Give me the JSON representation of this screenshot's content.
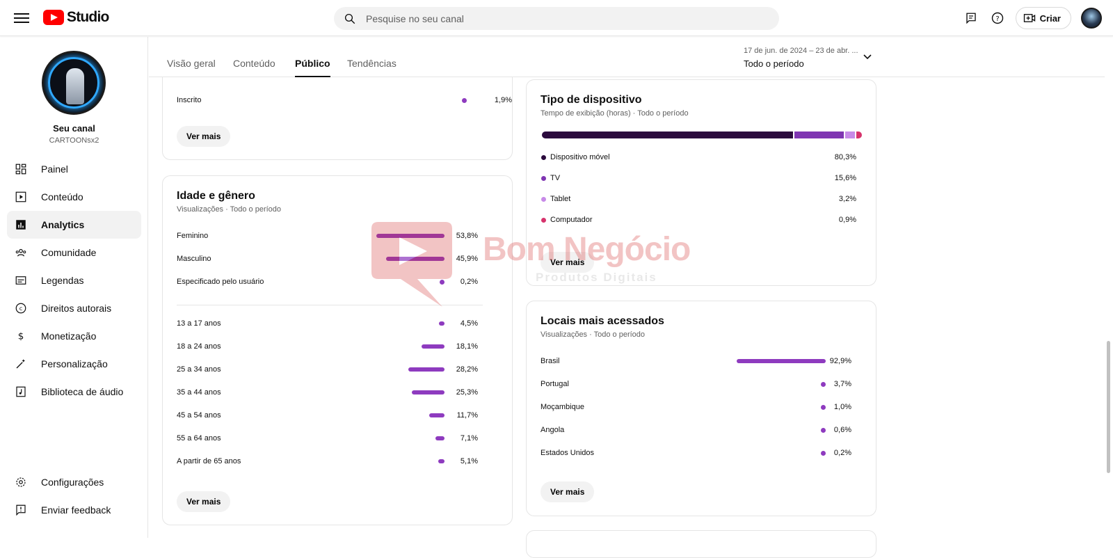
{
  "header": {
    "logo_text": "Studio",
    "search_placeholder": "Pesquise no seu canal",
    "create_label": "Criar"
  },
  "channel": {
    "title": "Seu canal",
    "handle": "CARTOONsx2"
  },
  "sidebar": {
    "items": [
      {
        "label": "Painel",
        "icon": "dashboard-icon"
      },
      {
        "label": "Conteúdo",
        "icon": "content-icon"
      },
      {
        "label": "Analytics",
        "icon": "analytics-icon",
        "active": true
      },
      {
        "label": "Comunidade",
        "icon": "community-icon"
      },
      {
        "label": "Legendas",
        "icon": "subtitles-icon"
      },
      {
        "label": "Direitos autorais",
        "icon": "copyright-icon"
      },
      {
        "label": "Monetização",
        "icon": "dollar-icon"
      },
      {
        "label": "Personalização",
        "icon": "magic-wand-icon"
      },
      {
        "label": "Biblioteca de áudio",
        "icon": "audio-library-icon"
      }
    ],
    "bottom": [
      {
        "label": "Configurações",
        "icon": "gear-icon"
      },
      {
        "label": "Enviar feedback",
        "icon": "feedback-icon"
      }
    ]
  },
  "tabs": [
    "Visão geral",
    "Conteúdo",
    "Público",
    "Tendências"
  ],
  "active_tab": "Público",
  "period": {
    "range": "17 de jun. de 2024 – 23 de abr. ...",
    "label": "Todo o período"
  },
  "subscribed_card": {
    "rows": [
      {
        "label": "Inscrito",
        "value": "1,9%"
      }
    ],
    "more": "Ver mais"
  },
  "age_gender": {
    "title": "Idade e gênero",
    "subtitle": "Visualizações · Todo o período",
    "gender": [
      {
        "label": "Feminino",
        "value": "53,8%",
        "pct": 53.8
      },
      {
        "label": "Masculino",
        "value": "45,9%",
        "pct": 45.9
      },
      {
        "label": "Especificado pelo usuário",
        "value": "0,2%",
        "pct": 0.2
      }
    ],
    "ages": [
      {
        "label": "13 a 17 anos",
        "value": "4,5%",
        "pct": 4.5
      },
      {
        "label": "18 a 24 anos",
        "value": "18,1%",
        "pct": 18.1
      },
      {
        "label": "25 a 34 anos",
        "value": "28,2%",
        "pct": 28.2
      },
      {
        "label": "35 a 44 anos",
        "value": "25,3%",
        "pct": 25.3
      },
      {
        "label": "45 a 54 anos",
        "value": "11,7%",
        "pct": 11.7
      },
      {
        "label": "55 a 64 anos",
        "value": "7,1%",
        "pct": 7.1
      },
      {
        "label": "A partir de 65 anos",
        "value": "5,1%",
        "pct": 5.1
      }
    ],
    "more": "Ver mais"
  },
  "device_type": {
    "title": "Tipo de dispositivo",
    "subtitle": "Tempo de exibição (horas) · Todo o período",
    "rows": [
      {
        "label": "Dispositivo móvel",
        "value": "80,3%",
        "pct": 80.3,
        "color": "#2b0a3d"
      },
      {
        "label": "TV",
        "value": "15,6%",
        "pct": 15.6,
        "color": "#7f35b2"
      },
      {
        "label": "Tablet",
        "value": "3,2%",
        "pct": 3.2,
        "color": "#c78ae8"
      },
      {
        "label": "Computador",
        "value": "0,9%",
        "pct": 0.9,
        "color": "#d6336c"
      }
    ],
    "more": "Ver mais"
  },
  "top_locations": {
    "title": "Locais mais acessados",
    "subtitle": "Visualizações · Todo o período",
    "rows": [
      {
        "label": "Brasil",
        "value": "92,9%",
        "pct": 92.9
      },
      {
        "label": "Portugal",
        "value": "3,7%",
        "pct": 3.7
      },
      {
        "label": "Moçambique",
        "value": "1,0%",
        "pct": 1.0
      },
      {
        "label": "Angola",
        "value": "0,6%",
        "pct": 0.6
      },
      {
        "label": "Estados Unidos",
        "value": "0,2%",
        "pct": 0.2
      }
    ],
    "more": "Ver mais"
  },
  "watermark": {
    "title": "Bom Negócio",
    "subtitle": "Produtos Digitais"
  },
  "colors": {
    "accent": "#8e3bbf",
    "brand_red": "#ff0000"
  }
}
